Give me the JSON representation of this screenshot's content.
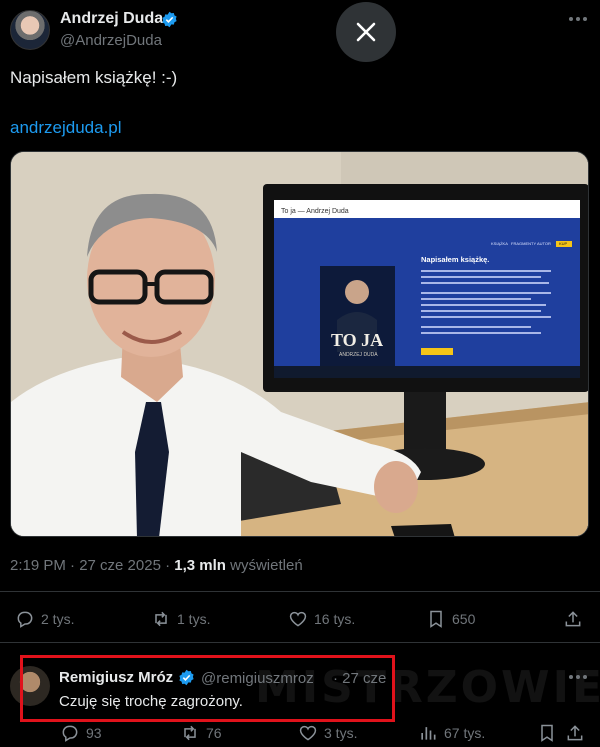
{
  "post": {
    "author_name": "Andrzej Duda",
    "author_handle": "@AndrzejDuda",
    "text": "Napisałem książkę! :-)",
    "link": "andrzejduda.pl",
    "timestamp": "2:19 PM · 27 cze 2025",
    "views_count": "1,3 mln",
    "views_label": "wyświetleń",
    "stats": {
      "replies": "2 tys.",
      "reposts": "1 tys.",
      "likes": "16 tys.",
      "bookmarks": "650"
    }
  },
  "media": {
    "screen_title": "To ja — Andrzej Duda",
    "screen_nav": [
      "KSIĄŻKA",
      "FRAGMENTY",
      "AUTOR",
      "KUP"
    ],
    "screen_heading": "Napisałem książkę.",
    "book_title": "TO JA",
    "book_author": "ANDRZEJ DUDA"
  },
  "reply": {
    "author_name": "Remigiusz Mróz",
    "author_handle": "@remigiuszmroz",
    "date": "· 27 cze",
    "text": "Czuję się trochę zagrożony.",
    "watermark": "MISTRZOWIE",
    "stats": {
      "replies": "93",
      "reposts": "76",
      "likes": "3 tys.",
      "views": "67 tys."
    }
  },
  "colors": {
    "background": "#000000",
    "text": "#e7e9ea",
    "muted": "#71767b",
    "link": "#1d9bf0",
    "verified": "#1d9bf0",
    "highlight": "#e0121b"
  }
}
